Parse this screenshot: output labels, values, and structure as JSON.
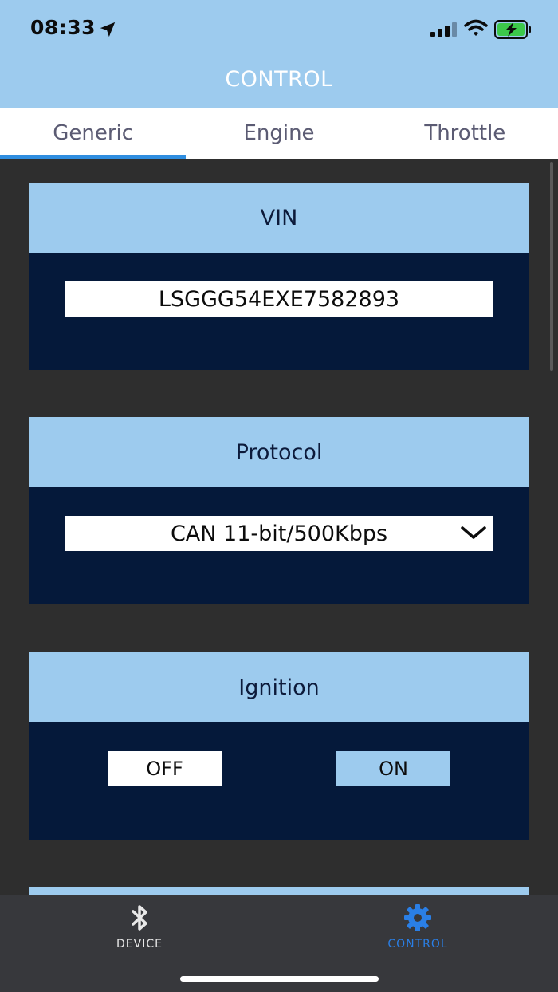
{
  "status": {
    "time": "08:33",
    "icons": [
      "location-arrow-icon",
      "signal-icon",
      "wifi-icon",
      "battery-charging-icon"
    ]
  },
  "header": {
    "title": "CONTROL"
  },
  "tabs": [
    {
      "label": "Generic",
      "active": true
    },
    {
      "label": "Engine",
      "active": false
    },
    {
      "label": "Throttle",
      "active": false
    }
  ],
  "cards": {
    "vin": {
      "title": "VIN",
      "value": "LSGGG54EXE7582893"
    },
    "protocol": {
      "title": "Protocol",
      "selected": "CAN 11-bit/500Kbps"
    },
    "ignition": {
      "title": "Ignition",
      "off_label": "OFF",
      "on_label": "ON"
    }
  },
  "tabbar": {
    "device_label": "DEVICE",
    "control_label": "CONTROL",
    "active": "control"
  },
  "colors": {
    "header_bg": "#9dcbee",
    "card_body": "#05193a",
    "accent": "#2f8ee0",
    "tabbar_active": "#2a7fe6",
    "tabbar_inactive": "#e8e8e8",
    "background": "#2e2e2e"
  }
}
